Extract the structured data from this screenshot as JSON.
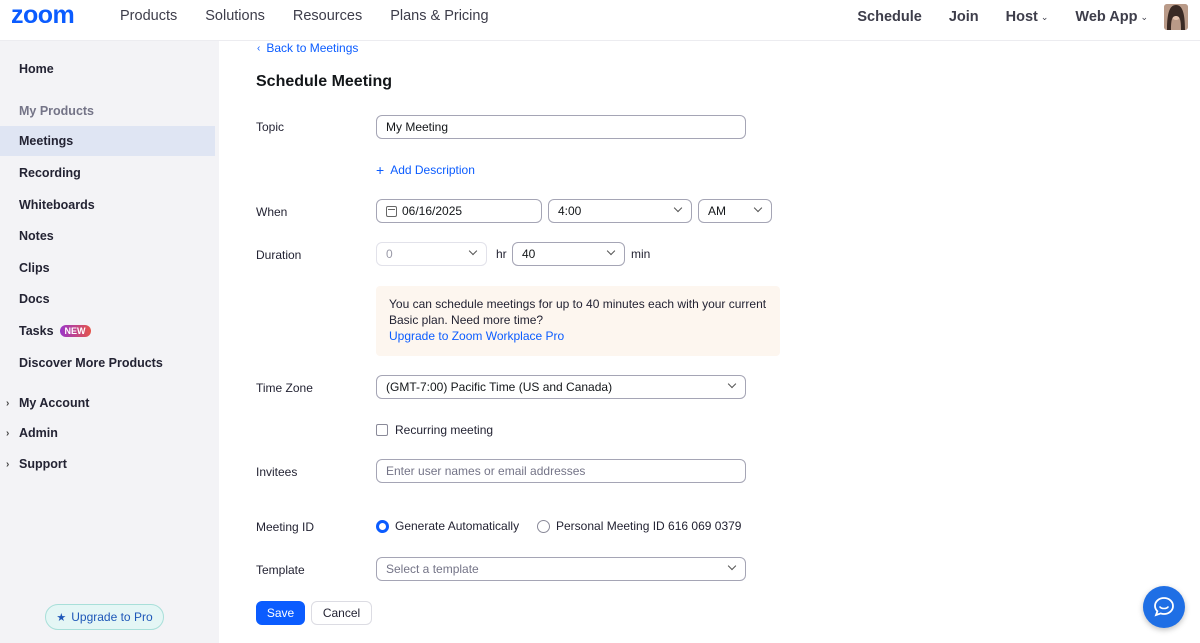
{
  "brand": {
    "logo_text": "zoom",
    "color": "#0b5cff"
  },
  "topnav": {
    "left": [
      "Products",
      "Solutions",
      "Resources",
      "Plans & Pricing"
    ],
    "right": {
      "schedule": "Schedule",
      "join": "Join",
      "host": "Host",
      "webapp": "Web App"
    }
  },
  "sidebar": {
    "home": "Home",
    "my_products": "My Products",
    "meetings": "Meetings",
    "recording": "Recording",
    "whiteboards": "Whiteboards",
    "notes": "Notes",
    "clips": "Clips",
    "docs": "Docs",
    "tasks": "Tasks",
    "tasks_badge": "NEW",
    "discover": "Discover More Products",
    "my_account": "My Account",
    "admin": "Admin",
    "support": "Support",
    "upgrade": "Upgrade to Pro"
  },
  "main": {
    "back": "Back to Meetings",
    "title": "Schedule Meeting",
    "topic_label": "Topic",
    "topic_value": "My Meeting",
    "add_description": "Add Description",
    "when_label": "When",
    "date_value": "06/16/2025",
    "time_value": "4:00",
    "ampm_value": "AM",
    "duration_label": "Duration",
    "duration_hr_value": "0",
    "hr_unit": "hr",
    "duration_min_value": "40",
    "min_unit": "min",
    "notice_text": "You can schedule meetings for up to 40 minutes each with your current Basic plan. Need more time?",
    "notice_link": "Upgrade to Zoom Workplace Pro",
    "timezone_label": "Time Zone",
    "timezone_value": "(GMT-7:00) Pacific Time (US and Canada)",
    "recurring_label": "Recurring meeting",
    "invitees_label": "Invitees",
    "invitees_placeholder": "Enter user names or email addresses",
    "meeting_id_label": "Meeting ID",
    "generate_auto": "Generate Automatically",
    "personal_id": "Personal Meeting ID 616 069 0379",
    "template_label": "Template",
    "template_placeholder": "Select a template",
    "save": "Save",
    "cancel": "Cancel"
  }
}
